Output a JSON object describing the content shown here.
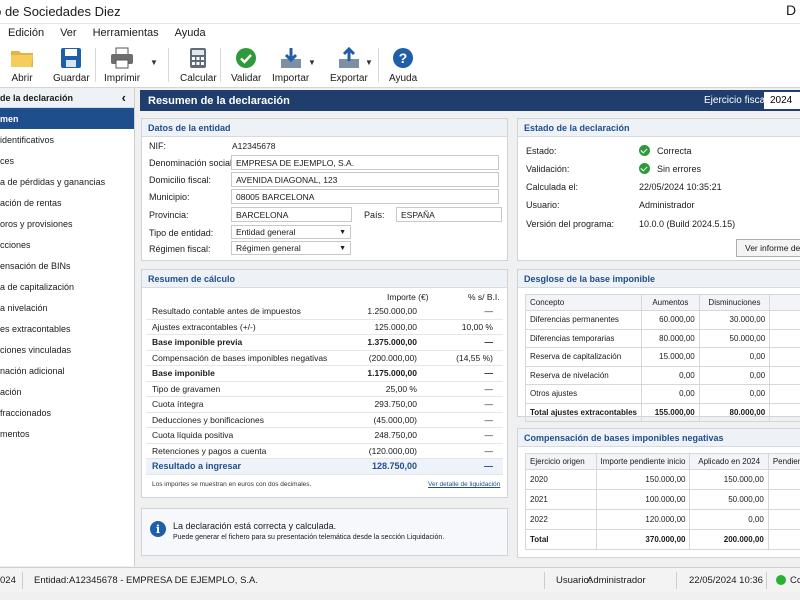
{
  "window": {
    "title": "sto de Sociedades Diez",
    "min_glyph": "D"
  },
  "menu": [
    "Edición",
    "Ver",
    "Herramientas",
    "Ayuda"
  ],
  "toolbar": {
    "open": "Abrir",
    "save": "Guardar",
    "print": "Imprimir",
    "calc": "Calcular",
    "validate": "Validar",
    "import": "Importar",
    "export": "Exportar",
    "help": "Ayuda"
  },
  "sidebar": {
    "header": "de la declaración",
    "collapse_glyph": "‹",
    "items": [
      "men",
      "identificativos",
      "ces",
      "a de pérdidas y ganancias",
      "ación de rentas",
      "oros y provisiones",
      "cciones",
      "ensación de BINs",
      "a de capitalización",
      "a nivelación",
      "es extracontables",
      "ciones vinculadas",
      "nación adicional",
      "ación",
      "fraccionados",
      "mentos"
    ]
  },
  "main": {
    "title": "Resumen de la declaración",
    "fiscal_label": "Ejercicio fiscal:",
    "fiscal_value": "2024"
  },
  "entity": {
    "title": "Datos de la entidad",
    "nif_label": "NIF:",
    "nif": "A12345678",
    "name_label": "Denominación social:",
    "name": "EMPRESA DE EJEMPLO, S.A.",
    "address_label": "Domicilio fiscal:",
    "address": "AVENIDA DIAGONAL, 123",
    "city_label": "Municipio:",
    "city": "08005 BARCELONA",
    "province_label": "Provincia:",
    "province": "BARCELONA",
    "country_label": "País:",
    "country": "ESPAÑA",
    "type_label": "Tipo de entidad:",
    "type": "Entidad general",
    "regime_label": "Régimen fiscal:",
    "regime": "Régimen general"
  },
  "status": {
    "title": "Estado de la declaración",
    "state_label": "Estado:",
    "state": "Correcta",
    "validation_label": "Validación:",
    "validation": "Sin errores",
    "calc_label": "Calculada el:",
    "calc_date": "22/05/2024 10:35:21",
    "user_label": "Usuario:",
    "user": "Administrador",
    "version_label": "Versión del programa:",
    "version": "10.0.0 (Build 2024.5.15)",
    "report_button": "Ver informe de validación"
  },
  "calc": {
    "title": "Resumen de cálculo",
    "col_amount": "Importe (€)",
    "col_pct": "% s/ B.I.",
    "rows": [
      {
        "concept": "Resultado contable antes de impuestos",
        "amount": "1.250.000,00",
        "pct": "—"
      },
      {
        "concept": "Ajustes extracontables (+/-)",
        "amount": "125.000,00",
        "pct": "10,00 %"
      },
      {
        "concept": "Base imponible previa",
        "amount": "1.375.000,00",
        "pct": "—"
      },
      {
        "concept": "Compensación de bases imponibles negativas",
        "amount": "(200.000,00)",
        "pct": "(14,55 %)"
      },
      {
        "concept": "Base imponible",
        "amount": "1.175.000,00",
        "pct": "—"
      },
      {
        "concept": "Tipo de gravamen",
        "amount": "25,00 %",
        "pct": "—"
      },
      {
        "concept": "Cuota íntegra",
        "amount": "293.750,00",
        "pct": "—"
      },
      {
        "concept": "Deducciones y bonificaciones",
        "amount": "(45.000,00)",
        "pct": "—"
      },
      {
        "concept": "Cuota líquida positiva",
        "amount": "248.750,00",
        "pct": "—"
      },
      {
        "concept": "Retenciones y pagos a cuenta",
        "amount": "(120.000,00)",
        "pct": "—"
      }
    ],
    "result_label": "Resultado a ingresar",
    "result_amount": "128.750,00",
    "result_pct": "—",
    "footnote": "Los importes se muestran en euros con dos decimales.",
    "detail_link": "Ver detalle de liquidación"
  },
  "breakdown": {
    "title": "Desglose de la base imponible",
    "headers": [
      "Concepto",
      "Aumentos",
      "Disminuciones",
      ""
    ],
    "rows": [
      [
        "Diferencias permanentes",
        "60.000,00",
        "30.000,00",
        "3"
      ],
      [
        "Diferencias temporarias",
        "80.000,00",
        "50.000,00",
        "3"
      ],
      [
        "Reserva de capitalización",
        "15.000,00",
        "0,00",
        "1"
      ],
      [
        "Reserva de nivelación",
        "0,00",
        "0,00",
        ""
      ],
      [
        "Otros ajustes",
        "0,00",
        "0,00",
        ""
      ]
    ],
    "total": [
      "Total ajustes extracontables",
      "155.000,00",
      "80.000,00",
      "75"
    ]
  },
  "bins": {
    "title": "Compensación de bases imponibles negativas",
    "headers": [
      "Ejercicio origen",
      "Importe pendiente inicio",
      "Aplicado en 2024",
      "Pendien"
    ],
    "rows": [
      [
        "2020",
        "150.000,00",
        "150.000,00",
        ""
      ],
      [
        "2021",
        "100.000,00",
        "50.000,00",
        "5"
      ],
      [
        "2022",
        "120.000,00",
        "0,00",
        "12"
      ]
    ],
    "total": [
      "Total",
      "370.000,00",
      "200.000,00",
      "170"
    ]
  },
  "info": {
    "title": "La declaración está correcta y calculada.",
    "text": "Puede generar el fichero para su presentación telemática desde la sección Liquidación.",
    "icon": "i"
  },
  "statusbar": {
    "year": "024",
    "entity_label": "Entidad:",
    "entity": "A12345678 - EMPRESA DE EJEMPLO, S.A.",
    "user_label": "Usuario:",
    "user": "Administrador",
    "datetime": "22/05/2024 10:36",
    "conn": "Co"
  },
  "colors": {
    "accent": "#1f4e8c",
    "header": "#1f3e6e",
    "ok": "#2f9a3a"
  }
}
